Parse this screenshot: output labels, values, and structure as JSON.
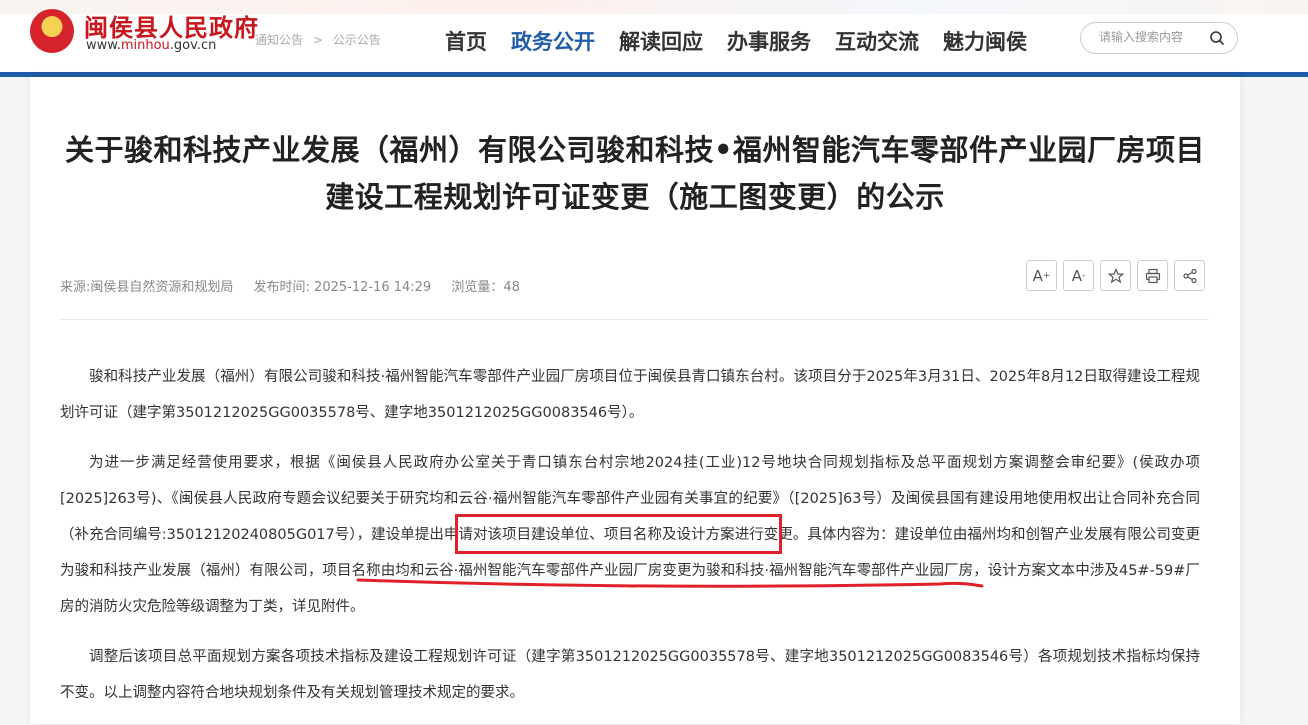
{
  "site": {
    "name": "闽侯县人民政府",
    "url_prefix": "www.",
    "url_highlight": "minhou",
    "url_suffix": ".gov.cn"
  },
  "breadcrumb": [
    "通知公告",
    ">",
    "公示公告"
  ],
  "nav": {
    "items": [
      "首页",
      "政务公开",
      "解读回应",
      "办事服务",
      "互动交流",
      "魅力闽侯"
    ],
    "active_index": 1
  },
  "search": {
    "placeholder": "请输入搜索内容",
    "icon": "search-icon"
  },
  "article": {
    "title_line1": "关于骏和科技产业发展（福州）有限公司骏和科技•福州智能汽车零部件产业园厂房项目",
    "title_line2": "建设工程规划许可证变更（施工图变更）的公示",
    "source": "来源:闽侯县自然资源和规划局",
    "publish_time": "发布时间: 2025-12-16 14:29",
    "views": "浏览量：48",
    "tools": {
      "font_up": "A",
      "font_up_sign": "+",
      "font_down": "A",
      "font_down_sign": "-",
      "favorite_icon": "star-icon",
      "print_icon": "printer-icon",
      "share_icon": "share-icon"
    },
    "paragraphs": [
      "骏和科技产业发展（福州）有限公司骏和科技·福州智能汽车零部件产业园厂房项目位于闽侯县青口镇东台村。该项目分于2025年3月31日、2025年8月12日取得建设工程规划许可证（建字第3501212025GG0035578号、建字地3501212025GG0083546号）。",
      "为进一步满足经营使用要求，根据《闽侯县人民政府办公室关于青口镇东台村宗地2024挂(工业)12号地块合同规划指标及总平面规划方案调整会审纪要》(侯政办项[2025]263号)、《闽侯县人民政府专题会议纪要关于研究均和云谷·福州智能汽车零部件产业园有关事宜的纪要》（[2025]63号）及闽侯县国有建设用地使用权出让合同补充合同（补充合同编号:35012120240805G017号），建设单提出申请对该项目建设单位、项目名称及设计方案进行变更。具体内容为：建设单位由福州均和创智产业发展有限公司变更为骏和科技产业发展（福州）有限公司，项目名称由均和云谷·福州智能汽车零部件产业园厂房变更为骏和科技·福州智能汽车零部件产业园厂房，设计方案文本中涉及45#-59#厂房的消防火灾危险等级调整为丁类，详见附件。",
      "调整后该项目总平面规划方案各项技术指标及建设工程规划许可证（建字第3501212025GG0035578号、建字地3501212025GG0083546号）各项规划技术指标均保持不变。以上调整内容符合地块规划条件及有关规划管理技术规定的要求。"
    ]
  },
  "colors": {
    "brand_red": "#c8161d",
    "nav_blue": "#1f5ca8",
    "annotation_red": "#e0202a"
  }
}
